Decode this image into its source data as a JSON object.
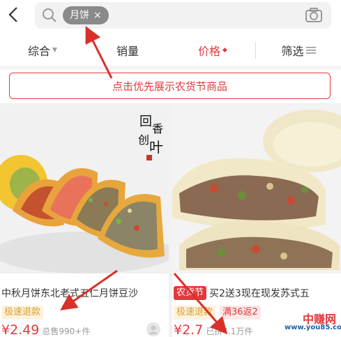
{
  "search": {
    "keyword": "月饼",
    "clear_icon": "×"
  },
  "tabs": [
    {
      "label": "综合",
      "active": false
    },
    {
      "label": "销量",
      "active": false
    },
    {
      "label": "价格",
      "active": true
    },
    {
      "label": "筛选",
      "active": false
    }
  ],
  "banner": {
    "text": "点击优先展示农货节商品"
  },
  "products": [
    {
      "title": "中秋月饼东北老式五仁月饼豆沙",
      "tags": [
        "极速退款"
      ],
      "price": "¥2.49",
      "sold": "总售990+件",
      "image_brand": "回香创叶"
    },
    {
      "badge": "农货节",
      "title": "买2送3现在现发苏式五",
      "tags": [
        "极速退款",
        "满36返2"
      ],
      "price": "¥2.7",
      "sold": "已拼4.1万件"
    }
  ],
  "watermark": {
    "name": "中赚网",
    "url": "www.you85.com"
  },
  "colors": {
    "accent": "#e4393c",
    "speed_tag": "#d7a033"
  }
}
